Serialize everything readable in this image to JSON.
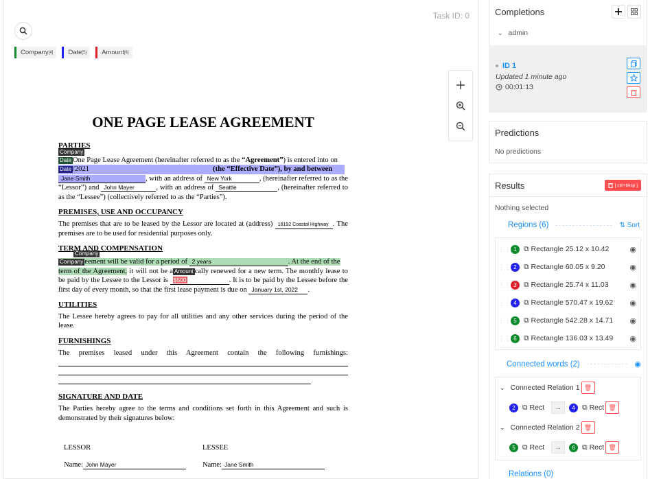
{
  "task_id": "Task ID: 0",
  "labels": [
    {
      "name": "Company",
      "count": "[4]",
      "color": "#0a8a2a"
    },
    {
      "name": "Date",
      "count": "[5]",
      "color": "#2222ee"
    },
    {
      "name": "Amount",
      "count": "[6]",
      "color": "#dd1f2c"
    }
  ],
  "doc": {
    "title": "ONE PAGE LEASE AGREEMENT",
    "parties_heading": "PARTIES",
    "tag_company": "Company",
    "tag_date": "Date",
    "tag_amount": "Amount",
    "p1a": "One Page Lease Agreement (hereinafter referred to as the ",
    "p1b": "“Agreement”",
    "p1c": ") is entered into on",
    "date_fragment": "/2021",
    "effective": "(the “Effective Date”), by and between",
    "lessee_name": "Jane Smith",
    "addr_text": ", with an address of",
    "city1": "New York",
    "ref_lessor": ", (hereinafter referred to as the “Lessor”) and",
    "lessor_name": "John Mayer",
    "addr_text2": ", with an address of",
    "city2": "Seattle",
    "ref_lessee": ", (hereinafter referred to as the “Lessee”) (collectively referred to as the “Parties”).",
    "premises_heading": "PREMISES, USE AND OCCUPANCY",
    "premises_a": "The premises that are to be leased by the Lessor are located at (address)",
    "premises_addr": "16192 Coastal Highway",
    "premises_b": ". The premises are to be used for residential purposes only.",
    "term_heading": "TERM AND COMPENSATION",
    "term_a": "eement will be valid for a period of",
    "term_period": "2 years",
    "term_b": ". At the end of the",
    "term_c": "term of the Agreement,",
    "term_d": " it will not be a",
    "term_e": "cally renewed for a new term. The monthly lease to be paid by the Lessee to the Lessor is",
    "rent": "$500",
    "term_f": ". It is to be paid by the Lessee before the first day of every month, so that the first lease payment is due on",
    "first_payment": "January 1st, 2022",
    "utilities_heading": "UTILITIES",
    "utilities_text": "The Lessee hereby agrees to pay for all utilities and any other services during the period of the lease.",
    "furnishings_heading": "FURNISHINGS",
    "furnishings_text": "The premises leased under this Agreement contain the following furnishings:",
    "signature_heading": "SIGNATURE AND DATE",
    "signature_text": "The Parties hereby agree to the terms and conditions set forth in this Agreement and such is demonstrated by their signatures below:",
    "lessor_label": "LESSOR",
    "lessee_label": "LESSEE",
    "name_label": "Name:",
    "sig_lessor": "John Mayer",
    "sig_lessee": "Jane Smith"
  },
  "sidebar": {
    "completions_title": "Completions",
    "user": "admin",
    "completion_id": "ID 1",
    "updated": "Updated 1 minute ago",
    "duration": "00:01:13",
    "predictions_title": "Predictions",
    "no_predictions": "No predictions",
    "results_title": "Results",
    "delete_shortcut": "[ ctrl+bksp ]",
    "nothing_selected": "Nothing selected",
    "regions_label": "Regions (6)",
    "sort_label": "Sort",
    "regions": [
      {
        "num": "1",
        "color": "#0a8a2a",
        "label": "Rectangle 25.12 x 10.42"
      },
      {
        "num": "2",
        "color": "#2222ee",
        "label": "Rectangle 60.05 x 9.20"
      },
      {
        "num": "3",
        "color": "#dd1f2c",
        "label": "Rectangle 25.74 x 11.03"
      },
      {
        "num": "4",
        "color": "#2222ee",
        "label": "Rectangle 570.47 x 19.62"
      },
      {
        "num": "5",
        "color": "#0a8a2a",
        "label": "Rectangle 542.28 x 14.71"
      },
      {
        "num": "6",
        "color": "#0a8a2a",
        "label": "Rectangle 136.03 x 13.49"
      }
    ],
    "connected_label": "Connected words (2)",
    "relations": [
      {
        "title": "Connected Relation 1",
        "from_num": "2",
        "from_color": "#2222ee",
        "to_num": "4",
        "to_color": "#2222ee",
        "from_text": "Rect",
        "to_text": "Rect"
      },
      {
        "title": "Connected Relation 2",
        "from_num": "5",
        "from_color": "#0a8a2a",
        "to_num": "6",
        "to_color": "#0a8a2a",
        "from_text": "Rect",
        "to_text": "Rect"
      }
    ],
    "relations_label": "Relations (0)"
  }
}
